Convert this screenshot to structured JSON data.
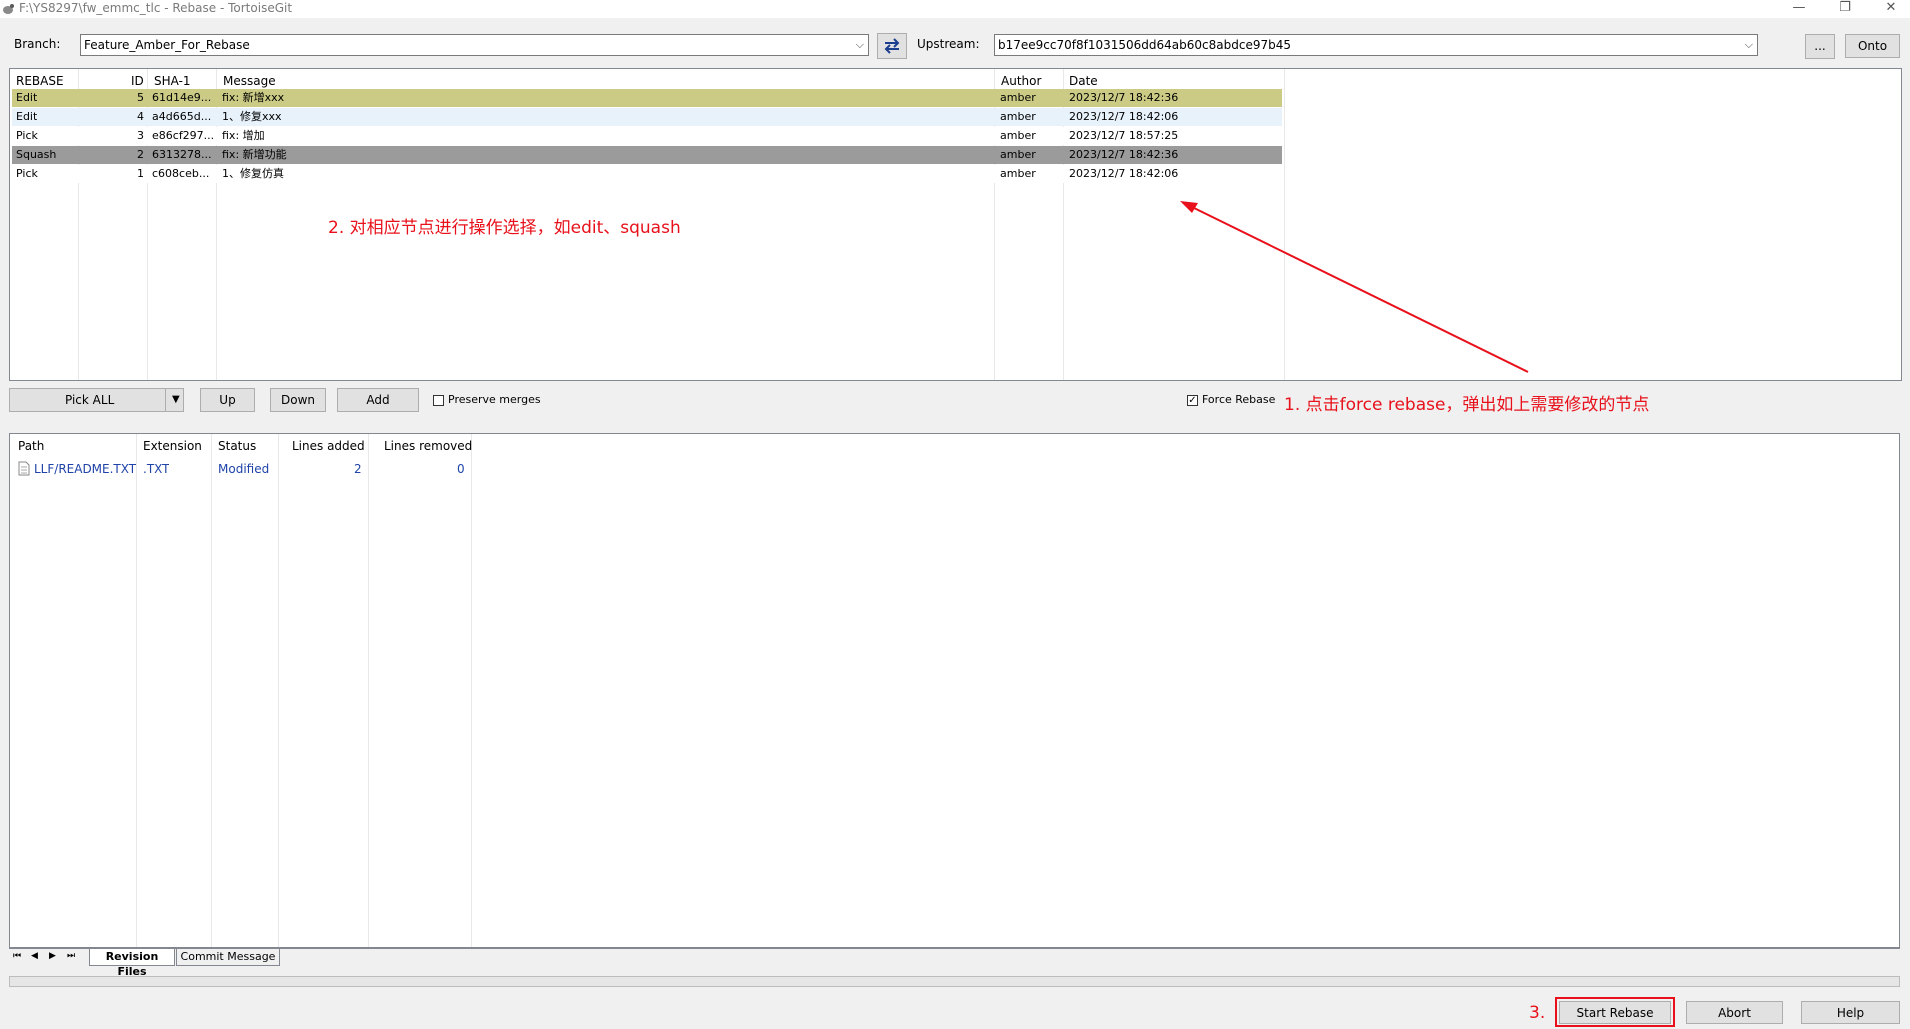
{
  "window": {
    "title": "F:\\YS8297\\fw_emmc_tlc - Rebase - TortoiseGit",
    "controls": {
      "minimize": "—",
      "restore": "❐",
      "close": "✕"
    }
  },
  "toolbar": {
    "branch_label": "Branch:",
    "branch_value": "Feature_Amber_For_Rebase",
    "upstream_label": "Upstream:",
    "upstream_value": "b17ee9cc70f8f1031506dd64ab60c8abdce97b45",
    "ellipsis_label": "...",
    "onto_label": "Onto"
  },
  "rebase_list": {
    "headers": {
      "rebase": "REBASE",
      "id": "ID",
      "sha": "SHA-1",
      "message": "Message",
      "author": "Author",
      "date": "Date"
    },
    "rows": [
      {
        "action": "Edit",
        "id": "5",
        "sha": "61d14e9...",
        "message": "fix: 新增xxx",
        "author": "amber",
        "date": "2023/12/7 18:42:36"
      },
      {
        "action": "Edit",
        "id": "4",
        "sha": "a4d665d...",
        "message": "1、修复xxx",
        "author": "amber",
        "date": "2023/12/7 18:42:06"
      },
      {
        "action": "Pick",
        "id": "3",
        "sha": "e86cf297...",
        "message": "fix: 增加",
        "author": "amber",
        "date": "2023/12/7 18:57:25"
      },
      {
        "action": "Squash",
        "id": "2",
        "sha": "6313278...",
        "message": "fix: 新增功能",
        "author": "amber",
        "date": "2023/12/7 18:42:36"
      },
      {
        "action": "Pick",
        "id": "1",
        "sha": "c608ceb...",
        "message": "1、修复仿真",
        "author": "amber",
        "date": "2023/12/7 18:42:06"
      }
    ],
    "row_colors": [
      "#cbcb86",
      "#e8f2fb",
      "#ffffff",
      "#9b9b9b",
      "#ffffff"
    ]
  },
  "annotations": {
    "step1": "1. 点击force rebase，弹出如上需要修改的节点",
    "step2": "2. 对相应节点进行操作选择，如edit、squash",
    "step3": "3.",
    "color": "#e8101a"
  },
  "actions": {
    "pick_all_label": "Pick ALL",
    "up_label": "Up",
    "down_label": "Down",
    "add_label": "Add",
    "preserve_merges_label": "Preserve merges",
    "preserve_merges_checked": false,
    "force_rebase_label": "Force Rebase",
    "force_rebase_checked": true
  },
  "files_list": {
    "headers": {
      "path": "Path",
      "extension": "Extension",
      "status": "Status",
      "lines_added": "Lines added",
      "lines_removed": "Lines removed"
    },
    "rows": [
      {
        "path": "LLF/README.TXT",
        "extension": ".TXT",
        "status": "Modified",
        "lines_added": "2",
        "lines_removed": "0",
        "icon": "text-file-icon"
      }
    ]
  },
  "tabs": {
    "nav": [
      "⏮",
      "◀",
      "▶",
      "⏭"
    ],
    "items": [
      {
        "label": "Revision Files",
        "active": true
      },
      {
        "label": "Commit Message",
        "active": false
      }
    ]
  },
  "footer": {
    "start_rebase_label": "Start Rebase",
    "abort_label": "Abort",
    "help_label": "Help"
  }
}
